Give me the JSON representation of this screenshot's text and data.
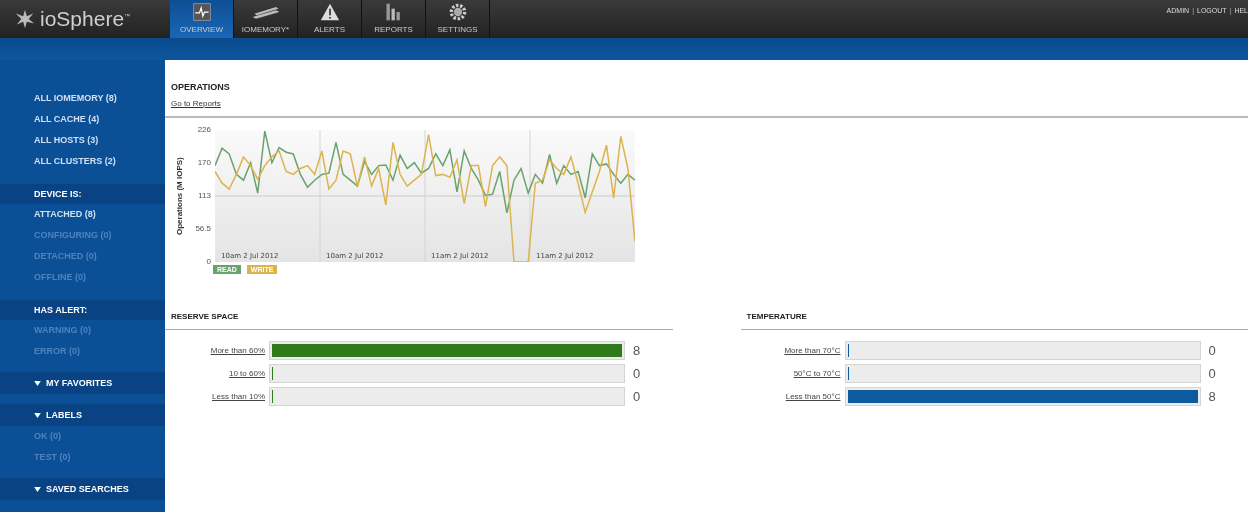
{
  "header": {
    "logo": {
      "text": "ioSphere",
      "mark": "$^{™}$"
    },
    "tabs": [
      {
        "label": "OVERVIEW",
        "selected": true
      },
      {
        "label": "IOMEMORY*",
        "selected": false
      },
      {
        "label": "ALERTS",
        "selected": false
      },
      {
        "label": "REPORTS",
        "selected": false
      },
      {
        "label": "SETTINGS",
        "selected": false
      }
    ],
    "user_links": [
      "ADMIN",
      "|",
      "LOGOUT",
      "|",
      "HEL"
    ]
  },
  "sidebar": {
    "items": [
      {
        "kind": "item",
        "label": "ALL IOMEMORY (8)",
        "disabled": false
      },
      {
        "kind": "item",
        "label": "ALL CACHE (4)",
        "disabled": false
      },
      {
        "kind": "item",
        "label": "ALL HOSTS (3)",
        "disabled": false
      },
      {
        "kind": "item",
        "label": "ALL CLUSTERS (2)",
        "disabled": false
      },
      {
        "kind": "heading",
        "label": "DEVICE IS:"
      },
      {
        "kind": "item",
        "label": "ATTACHED (8)",
        "disabled": false
      },
      {
        "kind": "item",
        "label": "CONFIGURING (0)",
        "disabled": true
      },
      {
        "kind": "item",
        "label": "DETACHED (0)",
        "disabled": true
      },
      {
        "kind": "item",
        "label": "OFFLINE (0)",
        "disabled": true
      },
      {
        "kind": "heading",
        "label": "HAS ALERT:"
      },
      {
        "kind": "item",
        "label": "WARNING (0)",
        "disabled": true
      },
      {
        "kind": "item",
        "label": "ERROR (0)",
        "disabled": true
      },
      {
        "kind": "group",
        "label": "MY FAVORITES"
      },
      {
        "kind": "group",
        "label": "LABELS"
      },
      {
        "kind": "item",
        "label": "OK (0)",
        "disabled": true
      },
      {
        "kind": "item",
        "label": "TEST (0)",
        "disabled": true
      },
      {
        "kind": "group",
        "label": "SAVED SEARCHES"
      }
    ]
  },
  "operations": {
    "title": "OPERATIONS",
    "link": "Go to Reports",
    "x_labels": [
      "10am 2 Jul 2012",
      "10am 2 Jul 2012",
      "11am 2 Jul 2012",
      "11am 2 Jul 2012"
    ],
    "chart_data": {
      "type": "line",
      "ylabel": "Operations (M IOPS)",
      "ylim": [
        0,
        226
      ],
      "yticks": [
        0,
        56.5,
        113,
        170,
        226
      ],
      "ref_lines": [
        {
          "axis": "y",
          "value": 113
        }
      ],
      "series": [
        {
          "name": "READ",
          "color": "#6aa26e",
          "values": [
            165,
            195,
            185,
            150,
            140,
            170,
            118,
            224,
            170,
            196,
            188,
            185,
            150,
            128,
            140,
            150,
            152,
            205,
            150,
            140,
            130,
            172,
            150,
            165,
            166,
            140,
            183,
            160,
            170,
            152,
            160,
            185,
            165,
            192,
            120,
            190,
            160,
            140,
            114,
            116,
            155,
            84,
            140,
            160,
            118,
            150,
            135,
            184,
            135,
            165,
            150,
            155,
            110,
            185,
            165,
            168,
            150,
            135,
            150,
            140
          ]
        },
        {
          "name": "WRITE",
          "color": "#dcb44f",
          "values": [
            155,
            135,
            125,
            150,
            180,
            165,
            142,
            165,
            180,
            190,
            155,
            150,
            160,
            165,
            150,
            190,
            125,
            140,
            190,
            185,
            130,
            180,
            130,
            160,
            98,
            205,
            150,
            130,
            140,
            150,
            218,
            148,
            150,
            145,
            175,
            100,
            165,
            165,
            95,
            165,
            180,
            165,
            0,
            0,
            0,
            135,
            140,
            175,
            160,
            150,
            180,
            135,
            85,
            120,
            155,
            200,
            110,
            215,
            160,
            35
          ]
        }
      ]
    }
  },
  "panels": [
    {
      "title": "RESERVE SPACE",
      "color": "#2f7a1a",
      "rows": [
        {
          "label": "More than 60%",
          "level": 1,
          "count": "8"
        },
        {
          "label": "10 to 60%",
          "level": 0,
          "count": "0"
        },
        {
          "label": "Less than 10%",
          "level": 0,
          "count": "0"
        }
      ]
    },
    {
      "title": "TEMPERATURE",
      "color": "#0d5aa0",
      "rows": [
        {
          "label": "More than 70°C",
          "level": 0,
          "count": "0"
        },
        {
          "label": "50°C to 70°C",
          "level": 0,
          "count": "0"
        },
        {
          "label": "Less than 50°C",
          "level": 1,
          "count": "8"
        }
      ]
    }
  ]
}
